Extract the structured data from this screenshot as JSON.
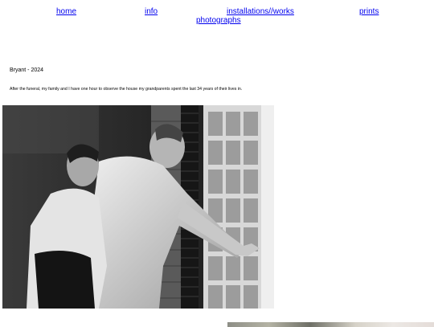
{
  "nav": {
    "home": "home",
    "info": "info",
    "works": "installations//works",
    "prints": "prints",
    "photographs": "photographs"
  },
  "post": {
    "title": "Bryant - 2024",
    "caption": "After the funeral, my family and I have one hour to observe the house my grandparents spent the last 34 years of their lives in."
  },
  "colors": {
    "link": "#0000ee",
    "background": "#ffffff"
  }
}
